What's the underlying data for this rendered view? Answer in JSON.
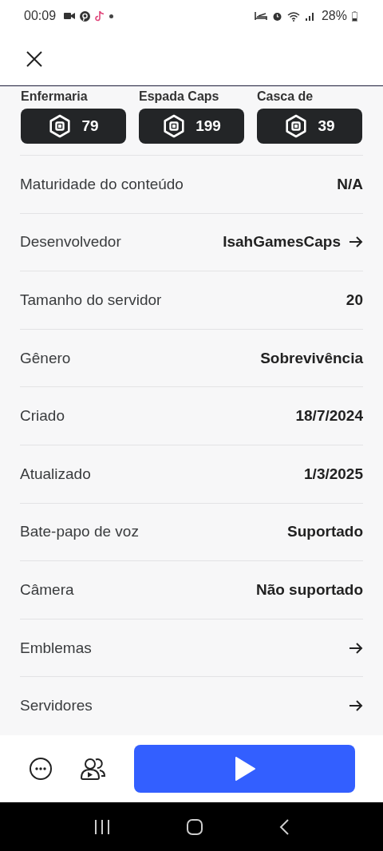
{
  "status_bar": {
    "time": "00:09",
    "battery": "28%"
  },
  "items": [
    {
      "name": "Enfermaria",
      "price": "79"
    },
    {
      "name": "Espada Caps",
      "price": "199"
    },
    {
      "name": "Casca de",
      "price": "39"
    }
  ],
  "details": [
    {
      "kind": "value",
      "label": "Maturidade do conteúdo",
      "value": "N/A"
    },
    {
      "kind": "link",
      "label": "Desenvolvedor",
      "value": "IsahGamesCaps"
    },
    {
      "kind": "value",
      "label": "Tamanho do servidor",
      "value": "20"
    },
    {
      "kind": "value",
      "label": "Gênero",
      "value": "Sobrevivência"
    },
    {
      "kind": "value",
      "label": "Criado",
      "value": "18/7/2024"
    },
    {
      "kind": "value",
      "label": "Atualizado",
      "value": "1/3/2025"
    },
    {
      "kind": "value",
      "label": "Bate-papo de voz",
      "value": "Suportado"
    },
    {
      "kind": "value",
      "label": "Câmera",
      "value": "Não suportado"
    },
    {
      "kind": "arrow",
      "label": "Emblemas"
    },
    {
      "kind": "arrow",
      "label": "Servidores"
    }
  ]
}
